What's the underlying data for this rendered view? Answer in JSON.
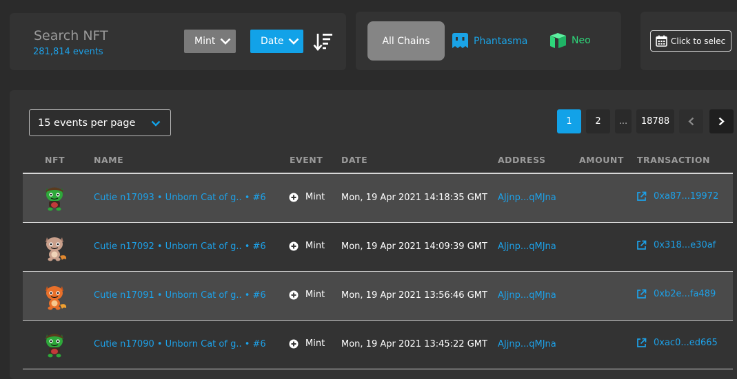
{
  "search": {
    "title": "Search NFT",
    "count": "281,814 events"
  },
  "filters": {
    "event_type": "Mint",
    "sort_field": "Date",
    "sort_icon": "sort-descending-icon"
  },
  "chains": {
    "all": "All Chains",
    "items": [
      "Phantasma",
      "Neo"
    ]
  },
  "date_picker": {
    "label": "Click to selec",
    "icon": "calendar-icon"
  },
  "per_page": {
    "label": "15 events per page"
  },
  "pagination": {
    "current": "1",
    "next": "2",
    "dots": "...",
    "last": "18788"
  },
  "table": {
    "headers": [
      "NFT",
      "NAME",
      "EVENT",
      "DATE",
      "ADDRESS",
      "AMOUNT",
      "TRANSACTION"
    ],
    "rows": [
      {
        "avatar": "green-cat-avatar",
        "name": "Cutie n17093 • Unborn Cat of g.. • #6",
        "event": "Mint",
        "date": "Mon, 19 Apr 2021 14:18:35 GMT",
        "address": "AJjnp...qMJna",
        "amount": "",
        "tx": "0xa87...19972"
      },
      {
        "avatar": "tan-cat-avatar",
        "name": "Cutie n17092 • Unborn Cat of g.. • #6",
        "event": "Mint",
        "date": "Mon, 19 Apr 2021 14:09:39 GMT",
        "address": "AJjnp...qMJna",
        "amount": "",
        "tx": "0x318...e30af"
      },
      {
        "avatar": "orange-cat-avatar",
        "name": "Cutie n17091 • Unborn Cat of g.. • #6",
        "event": "Mint",
        "date": "Mon, 19 Apr 2021 13:56:46 GMT",
        "address": "AJjnp...qMJna",
        "amount": "",
        "tx": "0xb2e...fa489"
      },
      {
        "avatar": "green-cat-avatar",
        "name": "Cutie n17090 • Unborn Cat of g.. • #6",
        "event": "Mint",
        "date": "Mon, 19 Apr 2021 13:45:22 GMT",
        "address": "AJjnp...qMJna",
        "amount": "",
        "tx": "0xac0...ed665"
      }
    ]
  },
  "colors": {
    "accent": "#12a2e8",
    "neo": "#2ed67a",
    "row_alt": "#4a4a4a",
    "panel": "#333333",
    "background": "#2b2b2b"
  }
}
